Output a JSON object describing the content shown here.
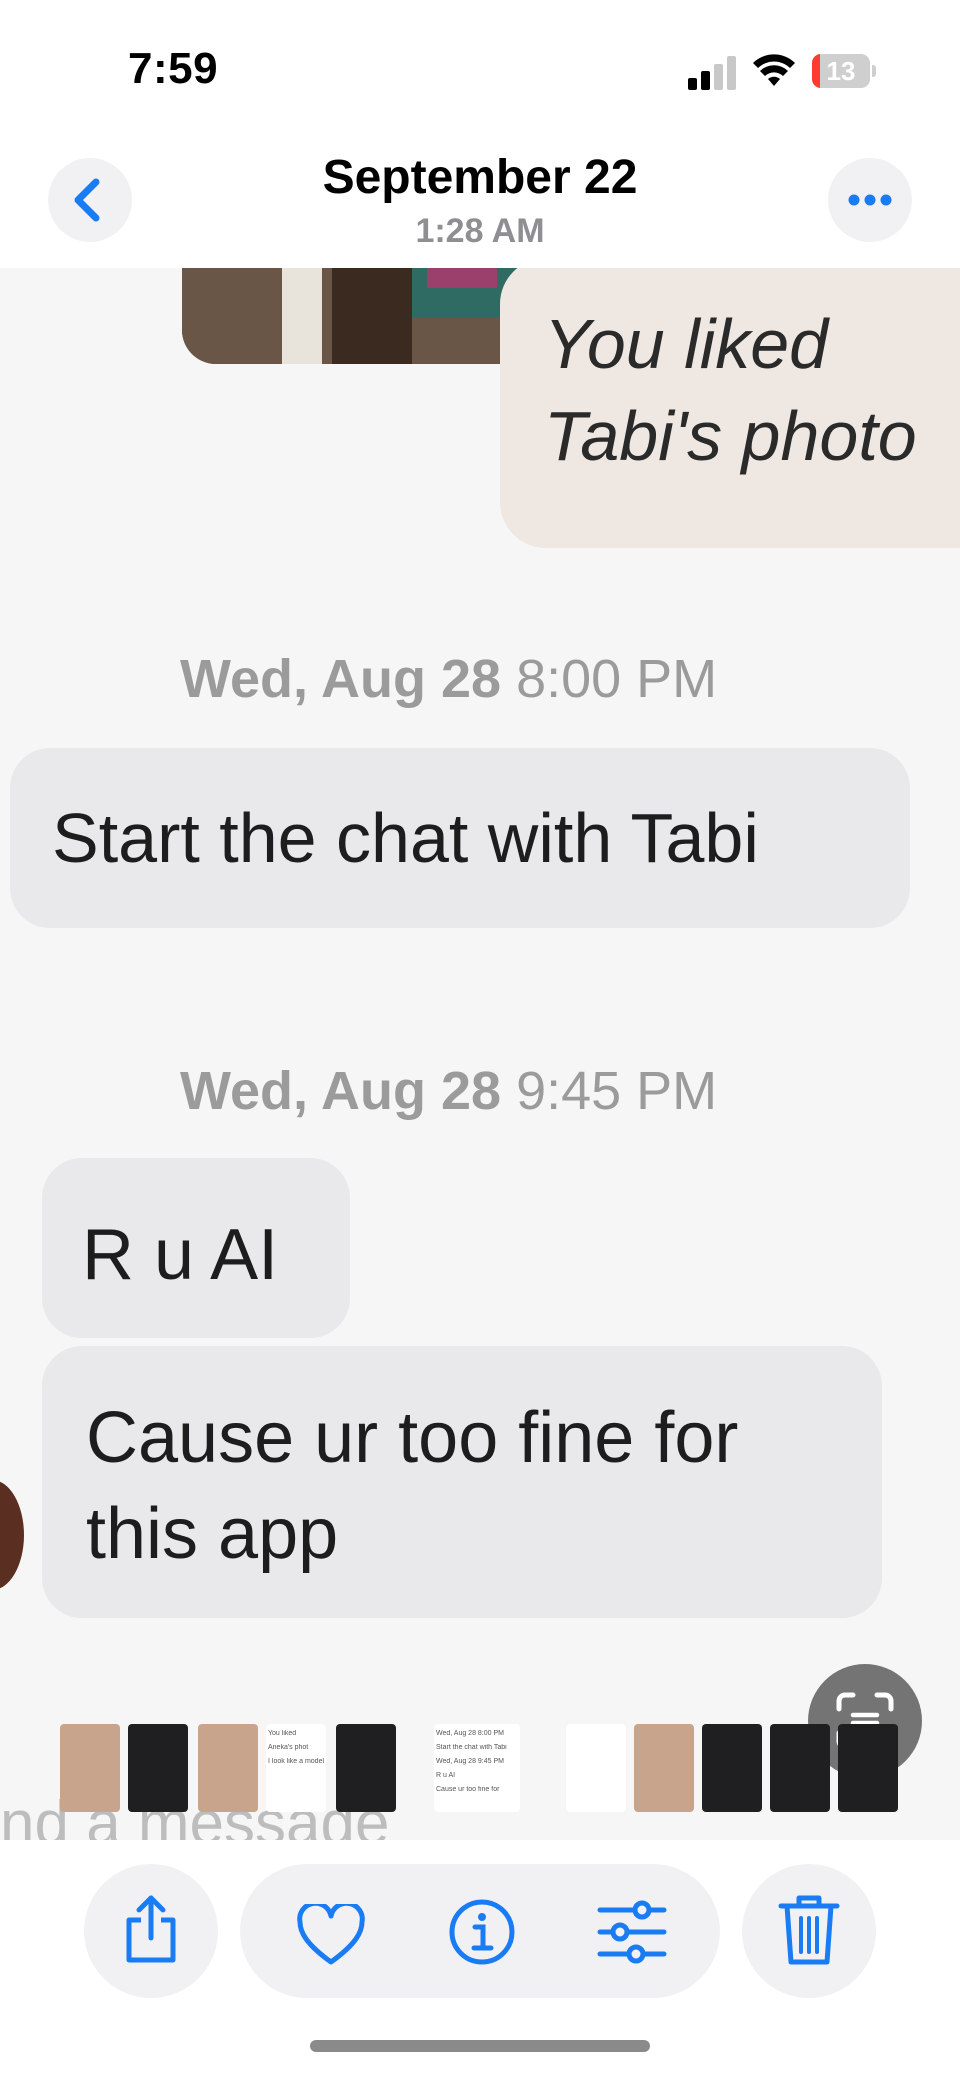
{
  "status_bar": {
    "time": "7:59",
    "battery": "13"
  },
  "header": {
    "title": "September 22",
    "subtitle": "1:28 AM"
  },
  "photo": {
    "liked_text": "You liked\nTabi's photo",
    "messages": [
      {
        "type": "date",
        "date": "Wed, Aug 28",
        "time": "8:00 PM"
      },
      {
        "type": "bubble",
        "text": "Start the chat with Tabi"
      },
      {
        "type": "date",
        "date": "Wed, Aug 28",
        "time": "9:45 PM"
      },
      {
        "type": "bubble",
        "text": "R u AI"
      },
      {
        "type": "bubble",
        "text": "Cause ur too fine for\nthis app"
      }
    ],
    "input_placeholder": "nd a message"
  },
  "thumbnails": [
    {
      "kind": "face"
    },
    {
      "kind": "dark"
    },
    {
      "kind": "face"
    },
    {
      "kind": "light",
      "lines": [
        "You liked",
        "Aneka's phot",
        "I look like a model"
      ]
    },
    {
      "kind": "dark"
    },
    {
      "kind": "light",
      "lines": [
        "Wed, Aug 28 8:00 PM",
        "Start the chat with Tabi",
        "Wed, Aug 28 9:45 PM",
        "R u AI",
        "Cause ur too fine for"
      ]
    },
    {
      "kind": "light"
    },
    {
      "kind": "face"
    },
    {
      "kind": "dark"
    },
    {
      "kind": "dark"
    },
    {
      "kind": "dark"
    }
  ],
  "toolbar": {
    "buttons": [
      "share-icon",
      "heart-icon",
      "info-icon",
      "adjust-icon",
      "trash-icon"
    ],
    "accent_color": "#1a7cf2"
  }
}
